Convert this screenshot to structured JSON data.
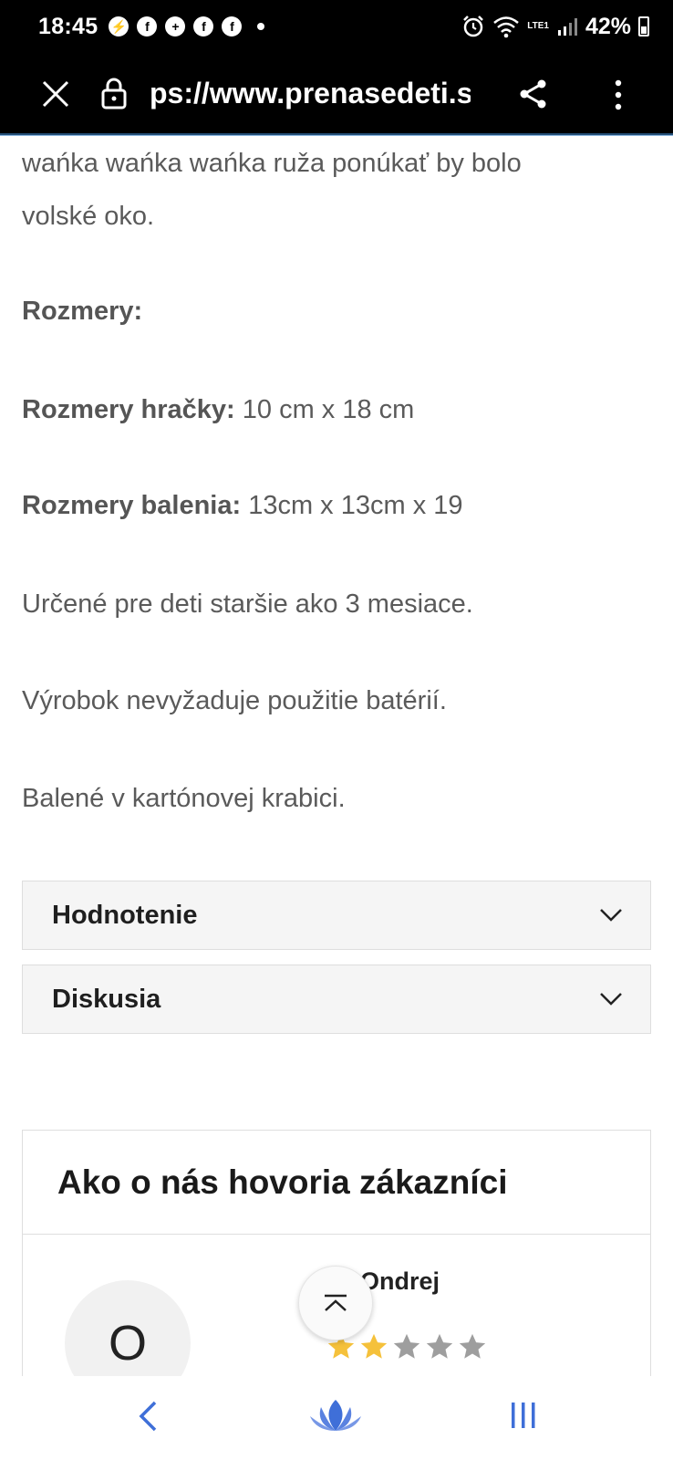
{
  "status_bar": {
    "time": "18:45",
    "battery": "42%",
    "network": "LTE1"
  },
  "browser": {
    "url": "ps://www.prenasedeti.sk/",
    "icons": [
      "close-icon",
      "lock-icon",
      "share-icon",
      "more-vert-icon"
    ]
  },
  "content": {
    "line1": "wańka wańka wańka ruža ponúkať by bolo",
    "line2": "volské oko.",
    "rozmery_heading": "Rozmery:",
    "toy_size_label": "Rozmery hračky:",
    "toy_size_value": " 10 cm x 18 cm",
    "package_size_label": "Rozmery balenia:",
    "package_size_value": " 13cm x 13cm x 19",
    "age_note": "Určené pre deti staršie ako 3 mesiace.",
    "battery_note": "Výrobok nevyžaduje použitie batérií.",
    "packaging_note": "Balené v kartónovej krabici."
  },
  "accordions": [
    {
      "label": "Hodnotenie"
    },
    {
      "label": "Diskusia"
    }
  ],
  "reviews": {
    "title": "Ako o nás hovoria zákazníci",
    "items": [
      {
        "avatar_letter": "O",
        "name": "Ondrej",
        "rating": 2,
        "max_rating": 5
      }
    ]
  },
  "colors": {
    "star_filled": "#f5c13b",
    "star_empty": "#9e9e9e",
    "nav_blue": "#3f6fd8"
  }
}
